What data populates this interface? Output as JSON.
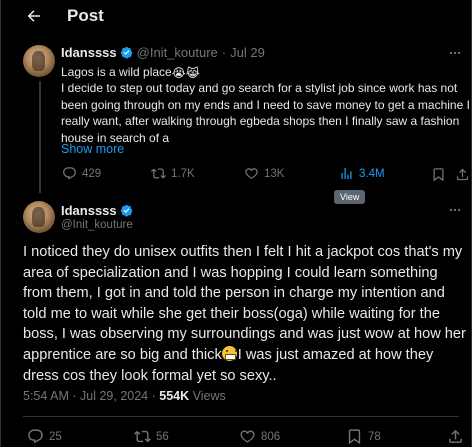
{
  "header": {
    "title": "Post"
  },
  "quoted_post": {
    "display_name": "Idanssss",
    "handle": "@Init_kouture",
    "separator": "·",
    "date": "Jul 29",
    "first_line": "Lagos is a wild place",
    "first_line_emojis": [
      "😭",
      "😹"
    ],
    "body": "I decide to step out today and go search for a stylist job since work has not been going through on my ends and I need to save money to get a machine I really want, after walking through egbeda shops then I finally saw a fashion house in search of a",
    "show_more": "Show more",
    "actions": {
      "replies": "429",
      "reposts": "1.7K",
      "likes": "13K",
      "views": "3.4M"
    },
    "tooltip": "View"
  },
  "main_post": {
    "display_name": "Idanssss",
    "handle": "@Init_kouture",
    "body_part1": "I noticed they do unisex outfits then I felt I hit a jackpot cos that's my area of specialization and I was hopping I could learn something from them, I got in and told the person in charge my intention and told me to wait while she get their boss(oga) while waiting for the boss, I was observing my surroundings and was just wow at how her apprentice are so big and thick",
    "body_part2": "I was just amazed at how they dress cos they look formal yet so sexy..",
    "time": "5:54 AM",
    "separator": "·",
    "date": "Jul 29, 2024",
    "separator2": "·",
    "views_count": "554K",
    "views_label": "Views",
    "actions": {
      "replies": "25",
      "reposts": "56",
      "likes": "806",
      "bookmarks": "78"
    }
  },
  "colors": {
    "accent": "#1d9bf0",
    "muted": "#71767b",
    "text": "#e7e9ea",
    "background": "#000000"
  },
  "icons": [
    "back-arrow-icon",
    "verified-badge-icon",
    "reply-icon",
    "repost-icon",
    "like-icon",
    "views-icon",
    "bookmark-icon",
    "share-icon",
    "more-icon",
    "grimace-emoji-icon"
  ]
}
